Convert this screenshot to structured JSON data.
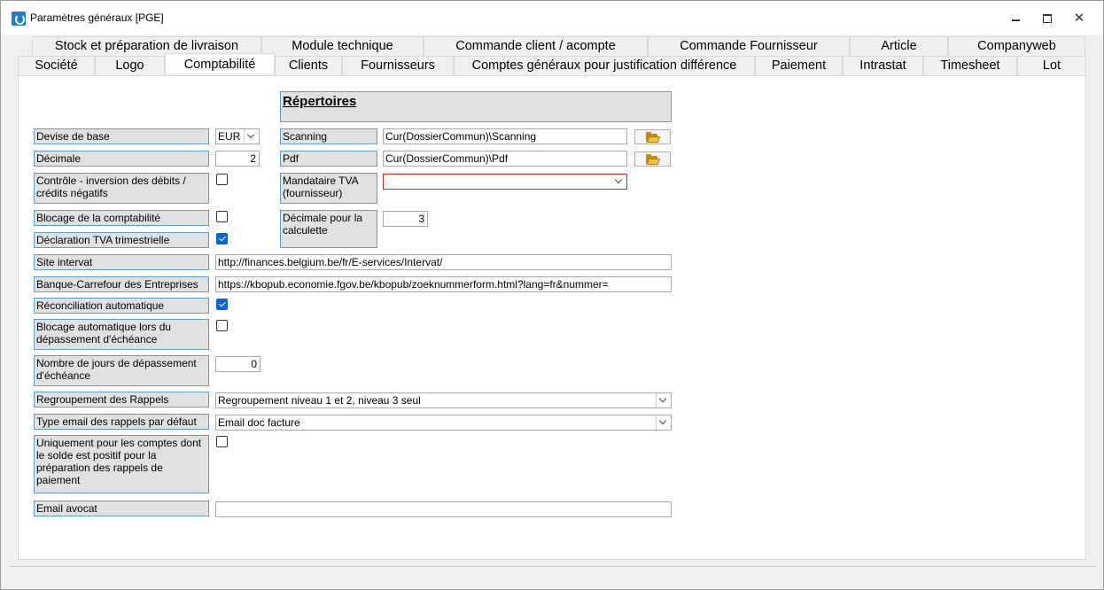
{
  "window": {
    "title": "Paramètres généraux [PGE]"
  },
  "tabs_row1": [
    "Stock et préparation de livraison",
    "Module technique",
    "Commande client / acompte",
    "Commande Fournisseur",
    "Article",
    "Companyweb"
  ],
  "tabs_row2": [
    "Société",
    "Logo",
    "Comptabilité",
    "Clients",
    "Fournisseurs",
    "Comptes généraux pour justification différence",
    "Paiement",
    "Intrastat",
    "Timesheet",
    "Lot"
  ],
  "active_tab": "Comptabilité",
  "left": {
    "devise_label": "Devise de base",
    "devise_value": "EUR",
    "decimale_label": "Décimale",
    "decimale_value": "2",
    "controle_label": "Contrôle - inversion des débits / crédits négatifs",
    "controle_checked": false,
    "blocage_label": "Blocage de la comptabilité",
    "blocage_checked": false,
    "declaration_label": "Déclaration TVA trimestrielle",
    "declaration_checked": true,
    "site_label": "Site intervat",
    "site_value": "http://finances.belgium.be/fr/E-services/Intervat/",
    "banque_label": "Banque-Carrefour des Entreprises",
    "banque_value": "https://kbopub.economie.fgov.be/kbopub/zoeknummerform.html?lang=fr&nummer=",
    "reconciliation_label": "Réconciliation automatique",
    "reconciliation_checked": true,
    "blocage_auto_label": "Blocage automatique lors du dépassement d'échéance",
    "blocage_auto_checked": false,
    "nombre_label": "Nombre de jours de dépassement d'échéance",
    "nombre_value": "0",
    "regroupement_label": "Regroupement des Rappels",
    "regroupement_value": "Regroupement niveau 1 et 2, niveau 3 seul",
    "type_email_label": "Type email des rappels par défaut",
    "type_email_value": "Email doc facture",
    "uniquement_label": "Uniquement pour les comptes dont le solde est positif pour la préparation des rappels de paiement",
    "uniquement_checked": false,
    "avocat_label": "Email avocat",
    "avocat_value": ""
  },
  "right": {
    "header": "Répertoires",
    "scanning_label": "Scanning",
    "scanning_value": "Cur(DossierCommun)\\Scanning",
    "pdf_label": "Pdf",
    "pdf_value": "Cur(DossierCommun)\\Pdf",
    "mandataire_label": "Mandataire TVA (fournisseur)",
    "mandataire_value": "",
    "decimale_calc_label": "Décimale pour la calculette",
    "decimale_calc_value": "3"
  },
  "icons": {
    "app": "app-icon",
    "minimize": "minimize-icon",
    "maximize": "maximize-icon",
    "close": "close-icon",
    "folder": "folder-open-icon",
    "dropdown": "chevron-down-icon",
    "check": "checkmark-icon"
  },
  "colors": {
    "label_bg": "#e1e1e1",
    "label_border": "#5f9cc8",
    "checkbox_on": "#0a64d6",
    "error_border": "#e02424"
  }
}
